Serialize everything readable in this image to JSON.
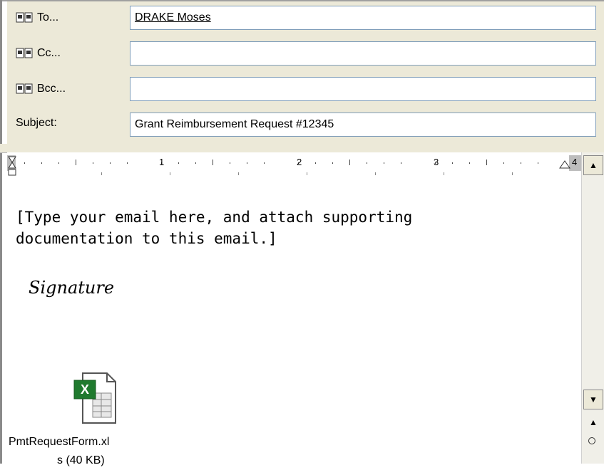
{
  "header": {
    "to": {
      "label": "To...",
      "value": "DRAKE Moses"
    },
    "cc": {
      "label": "Cc...",
      "value": ""
    },
    "bcc": {
      "label": "Bcc...",
      "value": ""
    },
    "subject": {
      "label": "Subject:",
      "value": "Grant Reimbursement Request #12345"
    }
  },
  "ruler": {
    "numbers": [
      "1",
      "2",
      "3",
      "4"
    ]
  },
  "body": {
    "line1": "[Type your email here, and attach supporting",
    "line2": "documentation to this email.]",
    "signature": "Signature"
  },
  "attachment": {
    "name_line1": "PmtRequestForm.xl",
    "name_line2": "s (40 KB)",
    "icon": "excel-file-icon"
  },
  "colors": {
    "excel_green": "#1f7a2e",
    "header_bg": "#ece9d8",
    "field_border": "#7f9db9"
  }
}
